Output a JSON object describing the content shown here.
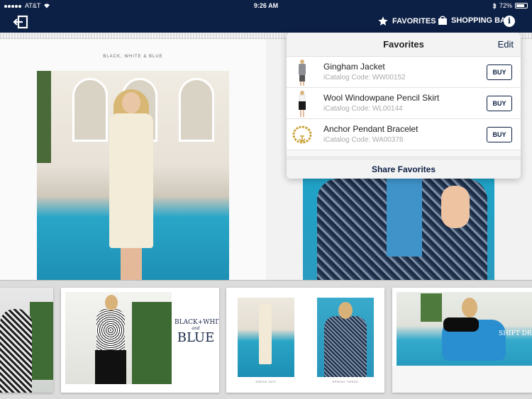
{
  "status_bar": {
    "carrier": "AT&T",
    "time": "9:26 AM",
    "battery": "72%"
  },
  "nav": {
    "favorites_label": "FAVORITES",
    "shopping_bag_label": "SHOPPING BAG",
    "info_label": "i"
  },
  "page": {
    "header": "BLACK, WHITE & BLUE"
  },
  "favorites": {
    "title": "Favorites",
    "edit_label": "Edit",
    "items": [
      {
        "name": "Gingham Jacket",
        "code": "iCatalog Code: WW00152",
        "buy_label": "BUY"
      },
      {
        "name": "Wool Windowpane Pencil Skirt",
        "code": "iCatalog Code: WL00144",
        "buy_label": "BUY"
      },
      {
        "name": "Anchor Pendant Bracelet",
        "code": "iCatalog Code: WA00378",
        "buy_label": "BUY"
      }
    ],
    "share_label": "Share Favorites"
  },
  "thumbnails": {
    "spread1_title_line1": "BLACK+WHITE",
    "spread1_title_line2": "and",
    "spread1_title_line3": "BLUE",
    "spread2_caption_left": "DRESS SUIT",
    "spread2_caption_right": "SPRING TWEED",
    "spread3_title": "SHIFT DRE"
  },
  "colors": {
    "brand_navy": "#0c1f44",
    "pool_blue": "#1d90b5"
  }
}
